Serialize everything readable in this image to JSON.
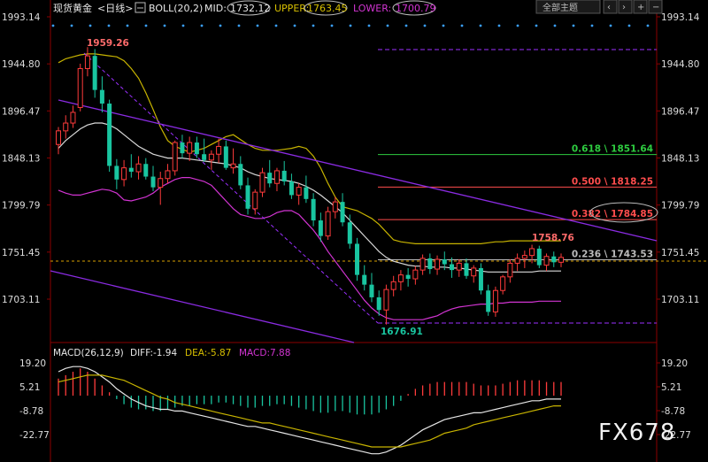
{
  "header": {
    "symbol": "现货黄金",
    "period": "<日线>",
    "boll_label": "BOLL(20,2)",
    "mid_label": "MID:",
    "mid_value": "1732.12",
    "upper_label": "UPPER:",
    "upper_value": "1763.45",
    "lower_label": "LOWER:",
    "lower_value": "1700.79",
    "button": "全部主题"
  },
  "price_axis": {
    "ticks": [
      1993.14,
      1944.8,
      1896.47,
      1848.13,
      1799.79,
      1751.45,
      1703.11
    ],
    "labels": [
      "1993.14",
      "1944.80",
      "1896.47",
      "1848.13",
      "1799.79",
      "1751.45",
      "1703.11"
    ]
  },
  "annotations": {
    "high": "1959.26",
    "low": "1676.91",
    "recent_high": "1758.76"
  },
  "fibonacci": [
    {
      "label": "0.618 \\ 1851.64",
      "price": 1851.64,
      "color": "#2ecc40"
    },
    {
      "label": "0.500 \\ 1818.25",
      "price": 1818.25,
      "color": "#ff4d4d"
    },
    {
      "label": "0.382 \\ 1784.85",
      "price": 1784.85,
      "color": "#ff4d4d"
    },
    {
      "label": "0.236 \\ 1743.53",
      "price": 1743.53,
      "color": "#bbbbbb"
    }
  ],
  "macd": {
    "label": "MACD(26,12,9)",
    "diff": "DIFF:-1.94",
    "dea": "DEA:-5.87",
    "macd": "MACD:7.88",
    "axis_labels": [
      "19.20",
      "5.21",
      "-8.78",
      "-22.77"
    ],
    "ticks": [
      19.2,
      5.21,
      -8.78,
      -22.77
    ]
  },
  "watermark": "FX678",
  "colors": {
    "up": "#ff3b3b",
    "down": "#19c5a0",
    "upper_band": "#c8b400",
    "mid_band": "#d9d9d9",
    "lower_band": "#d234d2",
    "trend": "#8a2be2",
    "dif": "#e6e6e6",
    "dea": "#c8b400"
  },
  "chart_data": {
    "type": "candlestick",
    "ohlc": [
      [
        1862,
        1880,
        1852,
        1876
      ],
      [
        1876,
        1892,
        1868,
        1884
      ],
      [
        1884,
        1902,
        1879,
        1895
      ],
      [
        1900,
        1945,
        1896,
        1940
      ],
      [
        1940,
        1962,
        1932,
        1953
      ],
      [
        1953,
        1960,
        1910,
        1918
      ],
      [
        1918,
        1932,
        1895,
        1904
      ],
      [
        1904,
        1908,
        1834,
        1840
      ],
      [
        1840,
        1847,
        1816,
        1826
      ],
      [
        1826,
        1846,
        1819,
        1838
      ],
      [
        1838,
        1852,
        1828,
        1834
      ],
      [
        1834,
        1850,
        1826,
        1842
      ],
      [
        1842,
        1848,
        1826,
        1829
      ],
      [
        1829,
        1840,
        1814,
        1818
      ],
      [
        1818,
        1834,
        1800,
        1827
      ],
      [
        1827,
        1842,
        1822,
        1835
      ],
      [
        1835,
        1866,
        1830,
        1864
      ],
      [
        1864,
        1872,
        1848,
        1853
      ],
      [
        1853,
        1870,
        1845,
        1864
      ],
      [
        1864,
        1870,
        1848,
        1852
      ],
      [
        1852,
        1868,
        1844,
        1846
      ],
      [
        1846,
        1856,
        1836,
        1852
      ],
      [
        1852,
        1868,
        1843,
        1860
      ],
      [
        1860,
        1866,
        1836,
        1838
      ],
      [
        1838,
        1858,
        1832,
        1842
      ],
      [
        1842,
        1850,
        1816,
        1820
      ],
      [
        1820,
        1828,
        1790,
        1796
      ],
      [
        1796,
        1816,
        1790,
        1813
      ],
      [
        1813,
        1838,
        1808,
        1833
      ],
      [
        1833,
        1846,
        1818,
        1822
      ],
      [
        1822,
        1838,
        1814,
        1835
      ],
      [
        1835,
        1845,
        1820,
        1824
      ],
      [
        1824,
        1832,
        1806,
        1810
      ],
      [
        1810,
        1822,
        1800,
        1818
      ],
      [
        1818,
        1830,
        1802,
        1806
      ],
      [
        1806,
        1812,
        1778,
        1784
      ],
      [
        1784,
        1792,
        1762,
        1768
      ],
      [
        1768,
        1798,
        1764,
        1793
      ],
      [
        1793,
        1808,
        1786,
        1803
      ],
      [
        1803,
        1812,
        1778,
        1782
      ],
      [
        1782,
        1790,
        1755,
        1760
      ],
      [
        1760,
        1766,
        1722,
        1728
      ],
      [
        1728,
        1738,
        1712,
        1718
      ],
      [
        1718,
        1730,
        1700,
        1705
      ],
      [
        1705,
        1712,
        1686,
        1692
      ],
      [
        1692,
        1718,
        1677,
        1713
      ],
      [
        1713,
        1727,
        1706,
        1721
      ],
      [
        1721,
        1733,
        1712,
        1728
      ],
      [
        1728,
        1735,
        1716,
        1724
      ],
      [
        1724,
        1737,
        1718,
        1733
      ],
      [
        1733,
        1749,
        1728,
        1745
      ],
      [
        1745,
        1750,
        1729,
        1734
      ],
      [
        1734,
        1748,
        1728,
        1744
      ],
      [
        1744,
        1752,
        1733,
        1739
      ],
      [
        1739,
        1746,
        1725,
        1733
      ],
      [
        1733,
        1744,
        1726,
        1740
      ],
      [
        1740,
        1745,
        1724,
        1727
      ],
      [
        1727,
        1738,
        1720,
        1735
      ],
      [
        1735,
        1740,
        1708,
        1712
      ],
      [
        1712,
        1718,
        1686,
        1690
      ],
      [
        1690,
        1716,
        1685,
        1712
      ],
      [
        1712,
        1728,
        1708,
        1726
      ],
      [
        1726,
        1744,
        1720,
        1740
      ],
      [
        1740,
        1750,
        1732,
        1745
      ],
      [
        1745,
        1753,
        1735,
        1748
      ],
      [
        1748,
        1759,
        1740,
        1755
      ],
      [
        1755,
        1758,
        1735,
        1738
      ],
      [
        1738,
        1750,
        1732,
        1747
      ],
      [
        1747,
        1752,
        1736,
        1741
      ],
      [
        1741,
        1750,
        1736,
        1746
      ]
    ],
    "boll_upper": [
      1946,
      1950,
      1952,
      1954,
      1955,
      1955,
      1954,
      1953,
      1952,
      1948,
      1940,
      1930,
      1915,
      1898,
      1880,
      1866,
      1860,
      1857,
      1854,
      1856,
      1858,
      1862,
      1866,
      1870,
      1872,
      1867,
      1862,
      1858,
      1856,
      1856,
      1856,
      1857,
      1858,
      1860,
      1858,
      1850,
      1838,
      1822,
      1808,
      1798,
      1796,
      1794,
      1790,
      1786,
      1780,
      1772,
      1764,
      1762,
      1761,
      1760,
      1760,
      1760,
      1760,
      1760,
      1760,
      1760,
      1760,
      1760,
      1760,
      1761,
      1762,
      1762,
      1763,
      1763,
      1763,
      1763,
      1763,
      1763,
      1763,
      1763
    ],
    "boll_mid": [
      1858,
      1866,
      1872,
      1878,
      1882,
      1884,
      1884,
      1882,
      1878,
      1872,
      1866,
      1860,
      1856,
      1852,
      1850,
      1848,
      1848,
      1848,
      1847,
      1846,
      1845,
      1844,
      1843,
      1842,
      1840,
      1838,
      1834,
      1831,
      1829,
      1827,
      1826,
      1825,
      1824,
      1822,
      1819,
      1815,
      1810,
      1804,
      1798,
      1792,
      1784,
      1776,
      1768,
      1760,
      1752,
      1746,
      1742,
      1740,
      1738,
      1737,
      1737,
      1736,
      1736,
      1736,
      1735,
      1735,
      1734,
      1733,
      1732,
      1731,
      1731,
      1731,
      1731,
      1731,
      1731,
      1731,
      1732,
      1732,
      1732,
      1732
    ],
    "boll_lower": [
      1815,
      1812,
      1810,
      1810,
      1812,
      1814,
      1816,
      1815,
      1812,
      1805,
      1804,
      1806,
      1808,
      1812,
      1818,
      1822,
      1826,
      1828,
      1828,
      1826,
      1824,
      1820,
      1812,
      1804,
      1796,
      1790,
      1788,
      1786,
      1786,
      1788,
      1792,
      1794,
      1794,
      1790,
      1782,
      1774,
      1764,
      1752,
      1742,
      1732,
      1722,
      1712,
      1702,
      1694,
      1688,
      1684,
      1682,
      1682,
      1682,
      1682,
      1682,
      1684,
      1686,
      1690,
      1693,
      1695,
      1696,
      1697,
      1698,
      1698,
      1699,
      1699,
      1700,
      1700,
      1700,
      1700,
      1701,
      1701,
      1701,
      1701
    ],
    "macd_hist": [
      10,
      12,
      14,
      16,
      14,
      10,
      6,
      2,
      -2,
      -5,
      -7,
      -8,
      -8,
      -9,
      -9,
      -8,
      -7,
      -6,
      -6,
      -5,
      -5,
      -5,
      -4,
      -4,
      -5,
      -6,
      -7,
      -7,
      -6,
      -6,
      -5,
      -5,
      -6,
      -7,
      -8,
      -9,
      -10,
      -10,
      -9,
      -9,
      -10,
      -11,
      -11,
      -11,
      -10,
      -8,
      -6,
      -3,
      1,
      4,
      6,
      7,
      8,
      8,
      8,
      8,
      8,
      7,
      6,
      6,
      6,
      7,
      8,
      9,
      9,
      9,
      9,
      8,
      8,
      8
    ],
    "macd_dif": [
      14,
      16,
      17,
      17,
      16,
      14,
      11,
      8,
      4,
      1,
      -2,
      -4,
      -6,
      -7,
      -8,
      -8,
      -9,
      -9,
      -10,
      -11,
      -12,
      -13,
      -14,
      -15,
      -16,
      -17,
      -18,
      -18,
      -19,
      -20,
      -21,
      -22,
      -23,
      -24,
      -25,
      -26,
      -27,
      -28,
      -29,
      -30,
      -31,
      -32,
      -33,
      -34,
      -34,
      -33,
      -31,
      -29,
      -26,
      -23,
      -20,
      -18,
      -16,
      -14,
      -13,
      -12,
      -11,
      -10,
      -10,
      -9,
      -8,
      -7,
      -6,
      -5,
      -4,
      -3,
      -3,
      -2,
      -2,
      -2
    ],
    "macd_dea": [
      8,
      9,
      10,
      11,
      12,
      12,
      12,
      11,
      10,
      9,
      7,
      5,
      3,
      1,
      -1,
      -2,
      -4,
      -5,
      -6,
      -7,
      -8,
      -9,
      -10,
      -11,
      -12,
      -13,
      -14,
      -15,
      -16,
      -16,
      -17,
      -18,
      -19,
      -20,
      -21,
      -22,
      -23,
      -24,
      -25,
      -26,
      -27,
      -28,
      -29,
      -30,
      -30,
      -30,
      -30,
      -30,
      -29,
      -28,
      -27,
      -26,
      -24,
      -22,
      -21,
      -20,
      -19,
      -17,
      -16,
      -15,
      -14,
      -13,
      -12,
      -11,
      -10,
      -9,
      -8,
      -7,
      -6,
      -6
    ],
    "ylim": [
      1676,
      1993
    ],
    "macd_ylim": [
      -30,
      22
    ]
  }
}
